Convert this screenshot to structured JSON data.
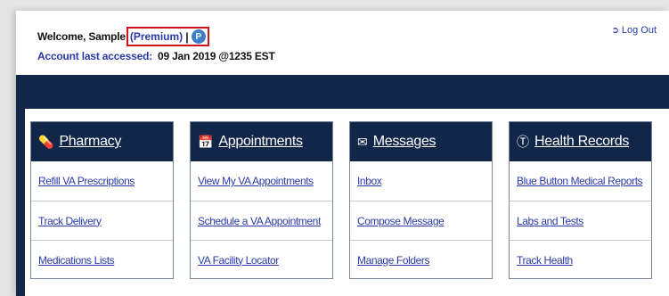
{
  "header": {
    "welcome_text": "Welcome, Sample",
    "premium_label": "(Premium)",
    "separator": "|",
    "badge_letter": "P",
    "last_accessed_label": "Account last accessed:",
    "last_accessed_value": "09 Jan 2019 @1235 EST",
    "logout_label": "Log Out"
  },
  "cards": [
    {
      "title": "Pharmacy",
      "icon": "pills-icon",
      "links": [
        "Refill VA Prescriptions",
        "Track Delivery",
        "Medications Lists"
      ]
    },
    {
      "title": "Appointments",
      "icon": "calendar-icon",
      "links": [
        "View My VA Appointments",
        "Schedule a VA Appointment",
        "VA Facility Locator"
      ]
    },
    {
      "title": "Messages",
      "icon": "messages-icon",
      "links": [
        "Inbox",
        "Compose Message",
        "Manage Folders"
      ]
    },
    {
      "title": "Health Records",
      "icon": "health-records-icon",
      "links": [
        "Blue Button Medical Reports",
        "Labs and Tests",
        "Track Health"
      ]
    }
  ],
  "colors": {
    "navy": "#12264a",
    "link": "#2a3aa8",
    "highlight": "#d0141b"
  }
}
